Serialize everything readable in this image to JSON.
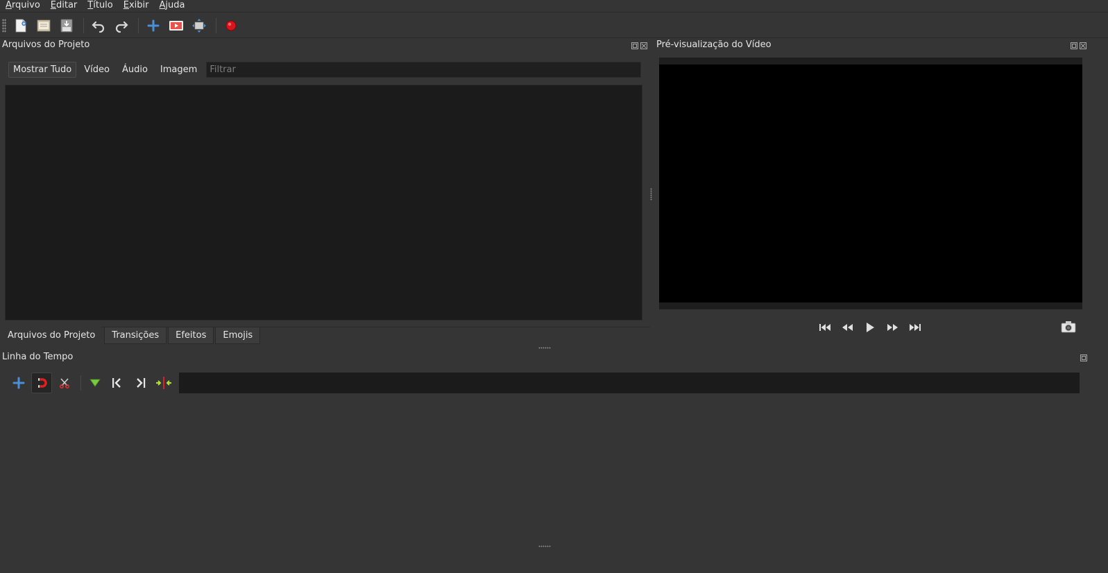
{
  "menu": {
    "items": [
      {
        "label": "Arquivo",
        "mnemonic": "A",
        "rest": "rquivo"
      },
      {
        "label": "Editar",
        "mnemonic": "E",
        "rest": "ditar"
      },
      {
        "label": "Título",
        "mnemonic": "T",
        "rest": "ítulo"
      },
      {
        "label": "Exibir",
        "mnemonic": "E",
        "rest": "xibir"
      },
      {
        "label": "Ajuda",
        "mnemonic": "A",
        "rest": "juda"
      }
    ]
  },
  "toolbar": {
    "icons": [
      "new-project-icon",
      "open-project-icon",
      "save-project-icon",
      "undo-icon",
      "redo-icon",
      "import-files-icon",
      "choose-profile-icon",
      "fullscreen-icon",
      "export-video-icon"
    ]
  },
  "project_files": {
    "title": "Arquivos do Projeto",
    "filters": [
      "Mostrar Tudo",
      "Vídeo",
      "Áudio",
      "Imagem"
    ],
    "filter_placeholder": "Filtrar"
  },
  "bottom_tabs": [
    "Arquivos do Projeto",
    "Transições",
    "Efeitos",
    "Emojis"
  ],
  "preview": {
    "title": "Pré-visualização do Vídeo",
    "controls": [
      "jump-start-icon",
      "rewind-icon",
      "play-icon",
      "fast-forward-icon",
      "jump-end-icon"
    ]
  },
  "timeline": {
    "title": "Linha do Tempo"
  },
  "colors": {
    "background": "#353535",
    "panel_dark": "#1b1b1b",
    "video_screen": "#000000",
    "accent_blue": "#4a90d9",
    "record_red": "#d9141c",
    "marker_green": "#7ac943"
  }
}
